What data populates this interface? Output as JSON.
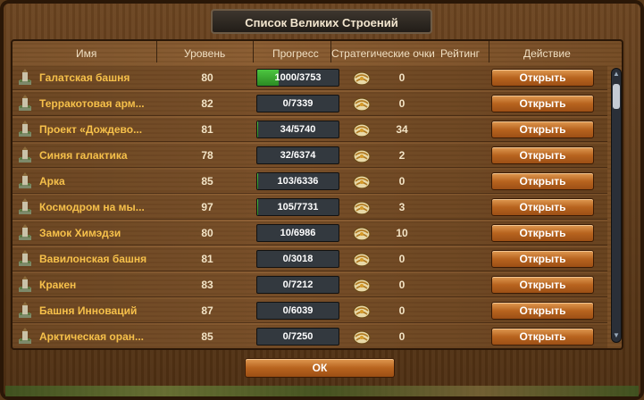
{
  "window": {
    "title": "Список Великих Строений",
    "ok_label": "ОК"
  },
  "columns": {
    "name": "Имя",
    "level": "Уровень",
    "progress": "Прогресс",
    "strategy_points": "Стратегические очки",
    "rating": "Рейтинг",
    "action": "Действие"
  },
  "colors": {
    "name_text": "#f6c04a",
    "progress_fill": "#3cb635",
    "button": "#b8641f"
  },
  "rows": [
    {
      "name": "Галатская башня",
      "level": "80",
      "progress": "1000/3753",
      "progress_fraction": 0.2665,
      "sp": "0",
      "action": "Открыть",
      "icon": "tower-icon"
    },
    {
      "name": "Терракотовая арм...",
      "level": "82",
      "progress": "0/7339",
      "progress_fraction": 0,
      "sp": "0",
      "action": "Открыть",
      "icon": "army-icon"
    },
    {
      "name": "Проект «Дождево...",
      "level": "81",
      "progress": "34/5740",
      "progress_fraction": 0.0059,
      "sp": "34",
      "action": "Открыть",
      "icon": "rain-project-icon"
    },
    {
      "name": "Синяя галактика",
      "level": "78",
      "progress": "32/6374",
      "progress_fraction": 0.005,
      "sp": "2",
      "action": "Открыть",
      "icon": "galaxy-icon"
    },
    {
      "name": "Арка",
      "level": "85",
      "progress": "103/6336",
      "progress_fraction": 0.0163,
      "sp": "0",
      "action": "Открыть",
      "icon": "arc-icon"
    },
    {
      "name": "Космодром на мы...",
      "level": "97",
      "progress": "105/7731",
      "progress_fraction": 0.0136,
      "sp": "3",
      "action": "Открыть",
      "icon": "spaceport-icon"
    },
    {
      "name": "Замок Химэдзи",
      "level": "80",
      "progress": "10/6986",
      "progress_fraction": 0.0014,
      "sp": "10",
      "action": "Открыть",
      "icon": "castle-icon"
    },
    {
      "name": "Вавилонская башня",
      "level": "81",
      "progress": "0/3018",
      "progress_fraction": 0,
      "sp": "0",
      "action": "Открыть",
      "icon": "babel-tower-icon"
    },
    {
      "name": "Кракен",
      "level": "83",
      "progress": "0/7212",
      "progress_fraction": 0,
      "sp": "0",
      "action": "Открыть",
      "icon": "kraken-icon"
    },
    {
      "name": "Башня Инноваций",
      "level": "87",
      "progress": "0/6039",
      "progress_fraction": 0,
      "sp": "0",
      "action": "Открыть",
      "icon": "innovation-tower-icon"
    },
    {
      "name": "Арктическая оран...",
      "level": "85",
      "progress": "0/7250",
      "progress_fraction": 0,
      "sp": "0",
      "action": "Открыть",
      "icon": "arctic-orangery-icon"
    }
  ]
}
